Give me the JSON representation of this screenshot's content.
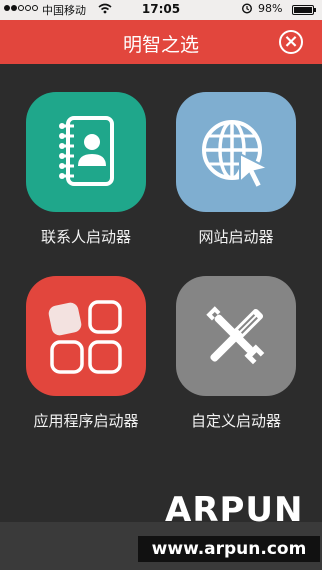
{
  "status_bar": {
    "signal_full": 2,
    "signal_empty": 3,
    "carrier": "中国移动",
    "wifi_icon": "wifi-icon",
    "time": "17:05",
    "alarm_icon": "alarm-icon",
    "battery_percent": "98%",
    "battery_level": 0.98
  },
  "header": {
    "title": "明智之选",
    "close_icon": "close-icon",
    "color": "#e2463d"
  },
  "launchers": [
    {
      "label": "联系人启动器",
      "icon": "contacts-book-icon",
      "color": "#1fa78b"
    },
    {
      "label": "网站启动器",
      "icon": "globe-cursor-icon",
      "color": "#7faed0"
    },
    {
      "label": "应用程序启动器",
      "icon": "app-grid-icon",
      "color": "#e2463d"
    },
    {
      "label": "自定义启动器",
      "icon": "tools-icon",
      "color": "#858585"
    }
  ],
  "watermark": {
    "logo": "ARPUN",
    "url": "www.arpun.com"
  }
}
